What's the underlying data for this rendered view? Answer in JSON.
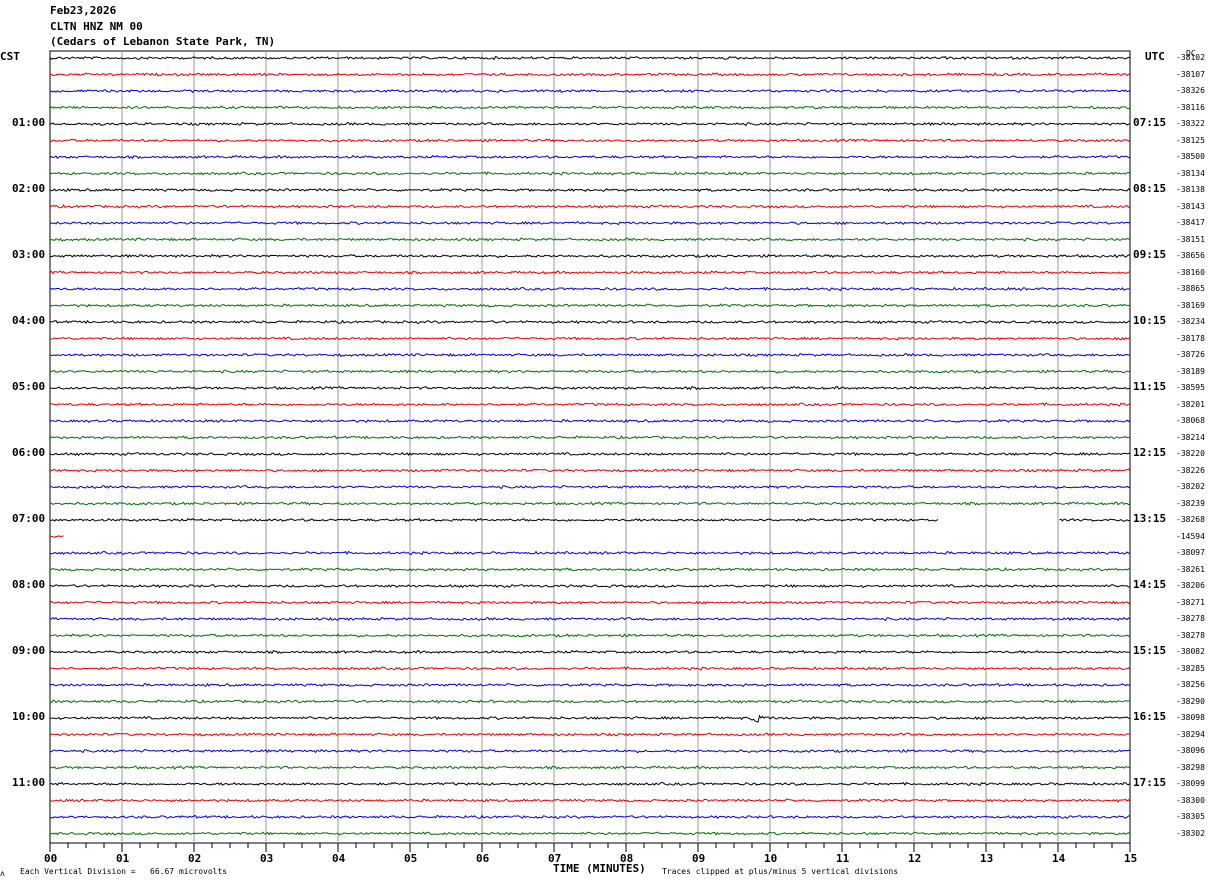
{
  "header": {
    "date": "Feb23,2026",
    "station": "CLTN HNZ NM 00",
    "location": "(Cedars of Lebanon State Park, TN)"
  },
  "left_tz": "CST",
  "right_tz": "UTC",
  "dc_label": "DC",
  "footer": {
    "vertical_division": "Each Vertical Division =   66.67 microvolts",
    "xlabel": "TIME (MINUTES)",
    "clip_note": "Traces clipped at plus/minus 5 vertical divisions"
  },
  "chart_data": {
    "type": "line",
    "title": "CLTN HNZ NM 00",
    "xlabel": "TIME (MINUTES)",
    "xlim": [
      0,
      15
    ],
    "x_ticks": [
      "00",
      "01",
      "02",
      "03",
      "04",
      "05",
      "06",
      "07",
      "08",
      "09",
      "10",
      "11",
      "12",
      "13",
      "14",
      "15"
    ],
    "trace_colors": [
      "#000000",
      "#e00000",
      "#0000d0",
      "#007000"
    ],
    "traces_per_hour": 4,
    "minutes_per_trace": 15,
    "left_hour_labels": [
      "01:00",
      "02:00",
      "03:00",
      "04:00",
      "05:00",
      "06:00",
      "07:00",
      "08:00",
      "09:00",
      "10:00",
      "11:00"
    ],
    "right_hour_labels": [
      "07:15",
      "08:15",
      "09:15",
      "10:15",
      "11:15",
      "12:15",
      "13:15",
      "14:15",
      "15:15",
      "16:15",
      "17:15"
    ],
    "dc_values": [
      "-38102",
      "-38107",
      "-38326",
      "-38116",
      "-38322",
      "-38125",
      "-38500",
      "-38134",
      "-38138",
      "-38143",
      "-38417",
      "-38151",
      "-38656",
      "-38160",
      "-38865",
      "-38169",
      "-38234",
      "-38178",
      "-38726",
      "-38189",
      "-38595",
      "-38201",
      "-38068",
      "-38214",
      "-38220",
      "-38226",
      "-38202",
      "-38239",
      "-38268",
      "-14594",
      "-38097",
      "-38261",
      "-38206",
      "-38271",
      "-38278",
      "-38278",
      "-38082",
      "-38285",
      "-38256",
      "-38290",
      "-38098",
      "-38294",
      "-38096",
      "-38298",
      "-38099",
      "-38300",
      "-38305",
      "-38302"
    ],
    "annotations": [
      {
        "text": "event",
        "trace_index": 40,
        "minute": 9.75
      },
      {
        "text": "data gap",
        "trace_index": 28,
        "minute_start": 12.35,
        "minute_end": 14.0
      },
      {
        "text": "data gap",
        "trace_index": 29,
        "minute_start": 0.2,
        "minute_end": 15.0
      }
    ]
  }
}
